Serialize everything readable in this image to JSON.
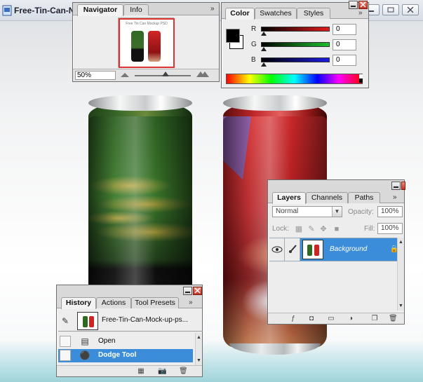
{
  "document": {
    "title": "Free-Tin-Can-N",
    "buttons": {
      "minimize": "▭",
      "restore": "▭"
    }
  },
  "navigator": {
    "tabs": [
      "Navigator",
      "Info"
    ],
    "menu_glyph": "»",
    "zoom_value": "50%",
    "zoom_level": 0.55
  },
  "color": {
    "tabs": [
      "Color",
      "Swatches",
      "Styles"
    ],
    "menu_glyph": "»",
    "channels": [
      {
        "label": "R",
        "value": "0",
        "color": "#e21b1b"
      },
      {
        "label": "G",
        "value": "0",
        "color": "#1bbf2a"
      },
      {
        "label": "B",
        "value": "0",
        "color": "#1b1be2"
      }
    ],
    "foreground": "#000000",
    "background": "#ffffff"
  },
  "layers": {
    "tabs": [
      "Layers",
      "Channels",
      "Paths"
    ],
    "menu_glyph": "»",
    "blend_mode": "Normal",
    "opacity_label": "Opacity:",
    "opacity_value": "100%",
    "lock_label": "Lock:",
    "fill_label": "Fill:",
    "fill_value": "100%",
    "rows": [
      {
        "name": "Background",
        "lock": "🔒",
        "selected": true
      }
    ]
  },
  "history": {
    "tabs": [
      "History",
      "Actions",
      "Tool Presets"
    ],
    "menu_glyph": "»",
    "snapshot_name": "Free-Tin-Can-Mock-up-ps...",
    "steps": [
      {
        "label": "Open",
        "selected": false
      },
      {
        "label": "Dodge Tool",
        "selected": true
      }
    ]
  },
  "colors": {
    "accent": "#3b8dd9",
    "panel": "#ededed"
  }
}
